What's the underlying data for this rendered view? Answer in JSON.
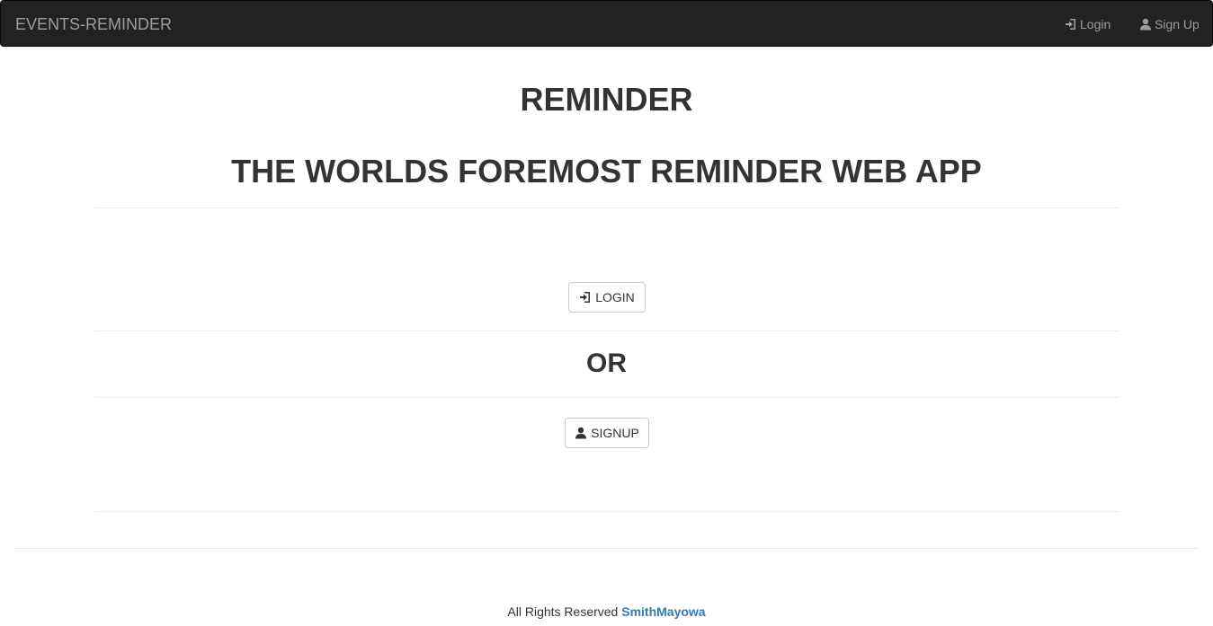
{
  "navbar": {
    "brand": "EVENTS-REMINDER",
    "links": [
      {
        "label": "Login",
        "icon": "log-in-icon"
      },
      {
        "label": "Sign Up",
        "icon": "user-icon"
      }
    ]
  },
  "main": {
    "title": "REMINDER",
    "subtitle": "THE WORLDS FOREMOST REMINDER WEB APP",
    "login_button": {
      "label": "LOGIN",
      "icon": "log-in-icon"
    },
    "separator_text": "OR",
    "signup_button": {
      "label": "SIGNUP",
      "icon": "user-icon"
    }
  },
  "footer": {
    "text": "All Rights Reserved",
    "author": "SmithMayowa"
  },
  "colors": {
    "navbar_bg": "#222222",
    "navbar_text": "#9d9d9d",
    "link": "#337ab7",
    "text": "#333333"
  }
}
